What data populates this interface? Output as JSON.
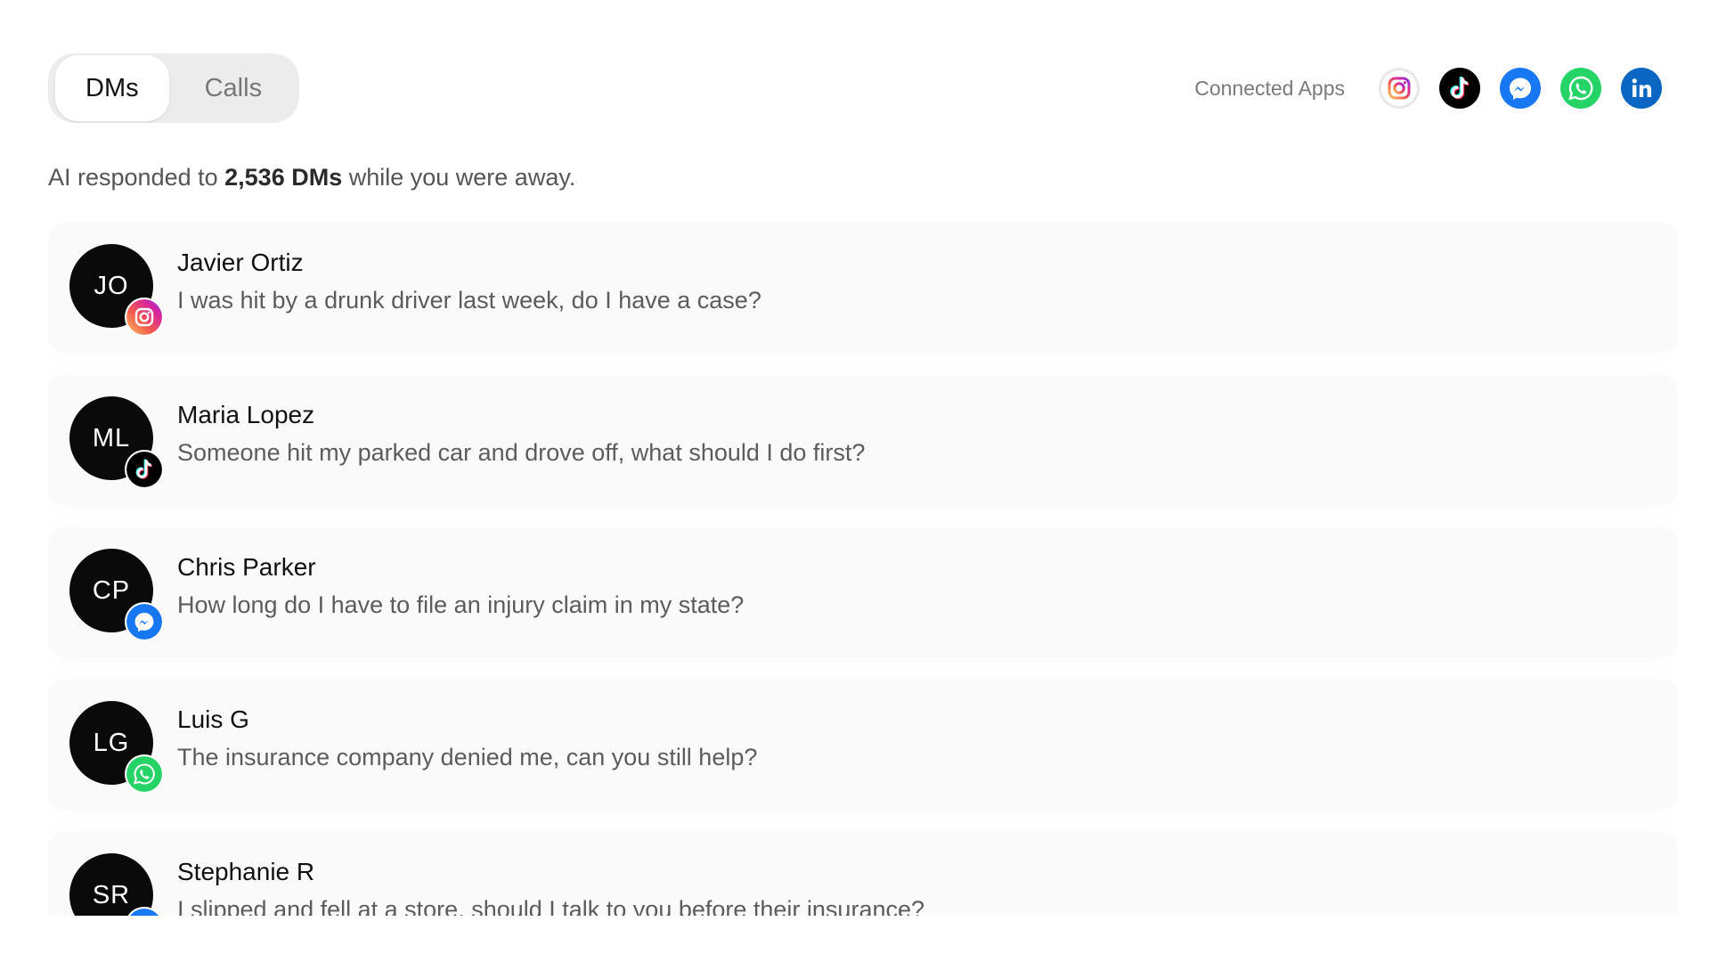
{
  "tabs": [
    {
      "label": "DMs",
      "active": true
    },
    {
      "label": "Calls",
      "active": false
    }
  ],
  "connected_apps": {
    "label": "Connected Apps",
    "apps": [
      "instagram-icon",
      "tiktok-icon",
      "messenger-icon",
      "whatsapp-icon",
      "linkedin-icon"
    ]
  },
  "summary": {
    "prefix": "AI responded to ",
    "count": "2,536 DMs",
    "suffix": " while you were away."
  },
  "conversations": [
    {
      "initials": "JO",
      "name": "Javier Ortiz",
      "message": "I was hit by a drunk driver last week, do I have a case?",
      "platform": "instagram"
    },
    {
      "initials": "ML",
      "name": "Maria Lopez",
      "message": "Someone hit my parked car and drove off, what should I do first?",
      "platform": "tiktok"
    },
    {
      "initials": "CP",
      "name": "Chris Parker",
      "message": "How long do I have to file an injury claim in my state?",
      "platform": "messenger"
    },
    {
      "initials": "LG",
      "name": "Luis G",
      "message": "The insurance company denied me, can you still help?",
      "platform": "whatsapp"
    },
    {
      "initials": "SR",
      "name": "Stephanie R",
      "message": "I slipped and fell at a store, should I talk to you before their insurance?",
      "platform": "messenger"
    }
  ],
  "colors": {
    "instagram": "#e1306c",
    "tiktok": "#000000",
    "messenger": "#1877f2",
    "whatsapp": "#25d366",
    "linkedin": "#0a66c2"
  }
}
